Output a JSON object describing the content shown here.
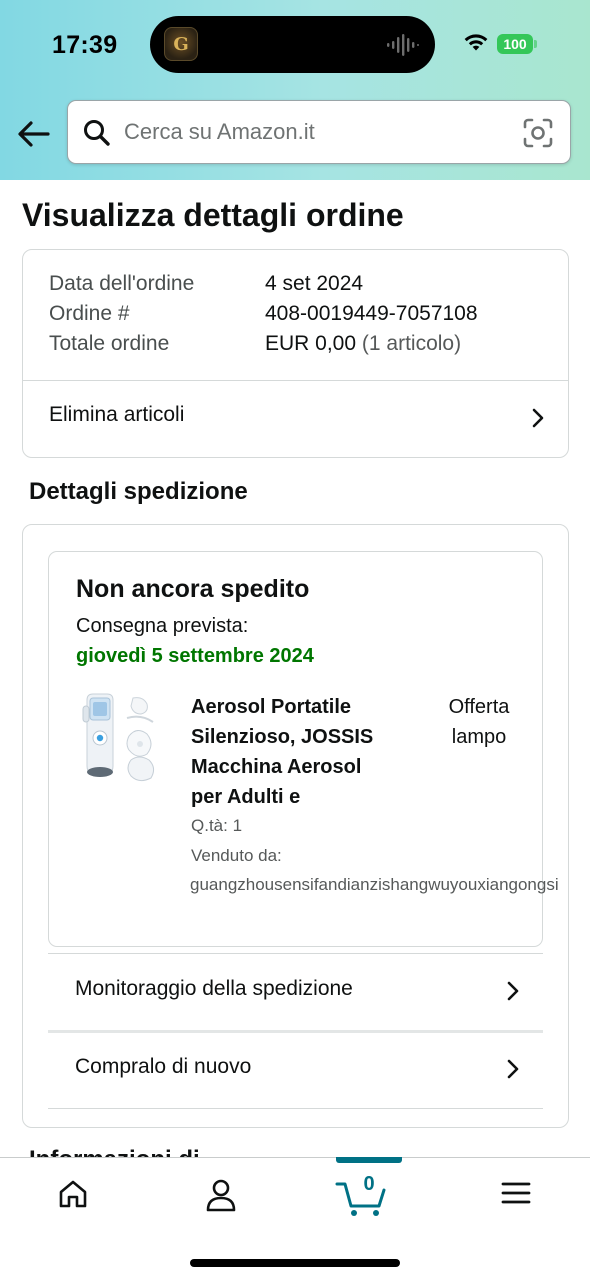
{
  "status_bar": {
    "time": "17:39",
    "battery": "100",
    "app_icon_letter": "G"
  },
  "header": {
    "search_placeholder": "Cerca su Amazon.it"
  },
  "page": {
    "title": "Visualizza dettagli ordine"
  },
  "order_summary": {
    "rows": [
      {
        "label": "Data dell'ordine",
        "value": "4 set 2024"
      },
      {
        "label": "Ordine #",
        "value": "408-0019449-7057108"
      },
      {
        "label": "Totale ordine",
        "value": "EUR 0,00",
        "value_suffix": "(1 articolo)"
      }
    ],
    "delete_items_label": "Elimina articoli"
  },
  "shipping": {
    "section_title": "Dettagli spedizione",
    "status": "Non ancora spedito",
    "delivery_label": "Consegna prevista:",
    "delivery_date": "giovedì 5 settembre 2024",
    "product": {
      "title_lines": [
        "Aerosol Portatile",
        "Silenzioso, JOSSIS",
        "Macchina Aerosol",
        "per Adulti e"
      ],
      "deal_badge_lines": [
        "Offerta",
        "lampo"
      ],
      "quantity": "Q.tà: 1",
      "sold_by_label": "Venduto da:",
      "seller": "guangzhousensifandianzishangwuyouxiangongsi"
    },
    "actions": [
      {
        "label": "Monitoraggio della spedizione"
      },
      {
        "label": "Compralo di nuovo"
      }
    ],
    "next_section_peek": "Informazioni di"
  },
  "tabbar": {
    "cart_count": "0",
    "tabs": [
      "home",
      "account",
      "cart",
      "menu"
    ]
  },
  "colors": {
    "header_gradient_start": "#82d8e3",
    "header_gradient_end": "#a9e6cf",
    "delivery_green": "#007600",
    "cart_teal": "#007185",
    "battery_green": "#34c759"
  },
  "icons": {
    "back": "arrow-left-icon",
    "search": "search-icon",
    "camera": "camera-scan-icon",
    "chevron": "chevron-right-icon",
    "home": "home-icon",
    "account": "user-icon",
    "cart": "cart-icon",
    "menu": "hamburger-menu-icon"
  }
}
